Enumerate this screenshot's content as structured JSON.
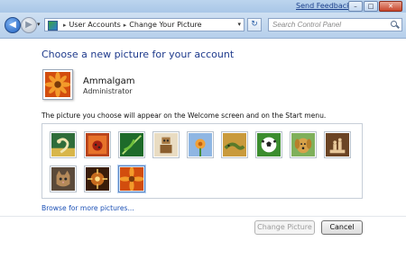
{
  "titlebar": {
    "feedback_label": "Send Feedback",
    "minimize_glyph": "–",
    "maximize_glyph": "□",
    "close_glyph": "✕"
  },
  "nav": {
    "back_glyph": "◀",
    "forward_glyph": "▶",
    "dropdown_glyph": "▾",
    "breadcrumb": [
      "User Accounts",
      "Change Your Picture"
    ],
    "breadcrumb_separator": "▸",
    "refresh_glyph": "↻",
    "search_placeholder": "Search Control Panel"
  },
  "main": {
    "title": "Choose a new picture for your account",
    "user": {
      "name": "Ammalgam",
      "role": "Administrator"
    },
    "description": "The picture you choose will appear on the Welcome screen and on the Start menu.",
    "pictures": [
      {
        "icon": "bass-clef-picture-icon"
      },
      {
        "icon": "ladybug-picture-icon"
      },
      {
        "icon": "leaf-picture-icon"
      },
      {
        "icon": "robot-picture-icon"
      },
      {
        "icon": "flower-picture-icon"
      },
      {
        "icon": "lizard-picture-icon"
      },
      {
        "icon": "soccer-ball-picture-icon"
      },
      {
        "icon": "dog-picture-icon"
      },
      {
        "icon": "chess-picture-icon"
      },
      {
        "icon": "kitten-picture-icon"
      },
      {
        "icon": "sparkle-picture-icon"
      },
      {
        "icon": "orange-flower-picture-icon"
      }
    ],
    "selected_picture": 12,
    "browse_label": "Browse for more pictures...",
    "change_button": "Change Picture",
    "cancel_button": "Cancel"
  },
  "colors": {
    "accent_title": "#1e3a8c",
    "link": "#1a4fb5",
    "selected_highlight": "#dceaf9"
  }
}
